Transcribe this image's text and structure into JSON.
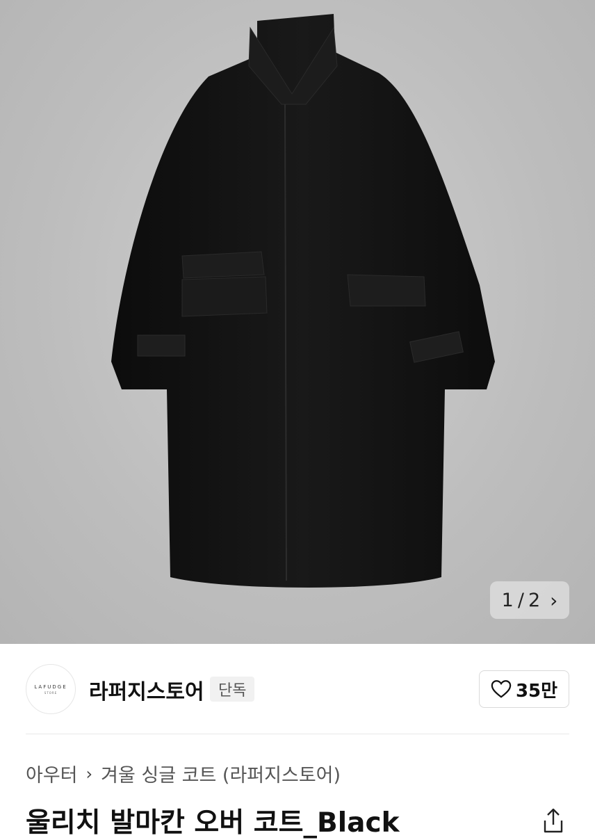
{
  "gallery": {
    "current": "1",
    "separator": "/",
    "total": "2",
    "image_alt": "black wool balmacaan over coat"
  },
  "brand": {
    "logo_text": "LAFUDGE",
    "logo_sub": "STORE",
    "name": "라퍼지스토어",
    "badge": "단독"
  },
  "like": {
    "count": "35만"
  },
  "breadcrumb": {
    "items": [
      "아우터",
      "겨울 싱글 코트 (라퍼지스토어)"
    ]
  },
  "product": {
    "title": "울리치 발마칸 오버 코트_Black"
  },
  "colors": {
    "background_photo": "#bdbdbd",
    "coat": "#141414"
  }
}
